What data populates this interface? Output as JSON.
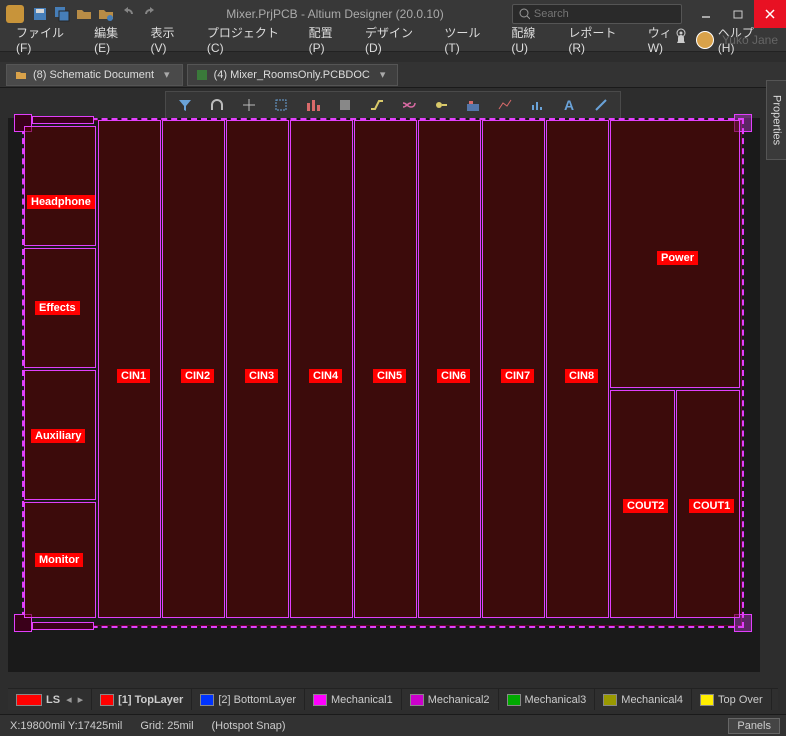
{
  "titlebar": {
    "title": "Mixer.PrjPCB - Altium Designer (20.0.10)",
    "search_placeholder": "Search"
  },
  "menu": {
    "file": "ファイル (F)",
    "edit": "編集 (E)",
    "view": "表示 (V)",
    "project": "プロジェクト (C)",
    "place": "配置 (P)",
    "design": "デザイン (D)",
    "tool": "ツール (T)",
    "route": "配線 (U)",
    "report": "レポート (R)",
    "win": "ウィ",
    "w_suffix": "W)",
    "help": "ヘルプ (H)",
    "user": "Yuko Jane"
  },
  "tabs": {
    "project": "(8) Schematic Document",
    "doc": "(4) Mixer_RoomsOnly.PCBDOC"
  },
  "rooms": {
    "headphone": "Headphone",
    "effects": "Effects",
    "auxiliary": "Auxiliary",
    "monitor": "Monitor",
    "cin1": "CIN1",
    "cin2": "CIN2",
    "cin3": "CIN3",
    "cin4": "CIN4",
    "cin5": "CIN5",
    "cin6": "CIN6",
    "cin7": "CIN7",
    "cin8": "CIN8",
    "power": "Power",
    "cout1": "COUT1",
    "cout2": "COUT2"
  },
  "layers": {
    "ls": "LS",
    "top": "[1] TopLayer",
    "bottom": "[2] BottomLayer",
    "m1": "Mechanical1",
    "m2": "Mechanical2",
    "m3": "Mechanical3",
    "m4": "Mechanical4",
    "tover": "Top Over"
  },
  "colors": {
    "top": "#ff0000",
    "bottom": "#0033ff",
    "m1": "#ff00ff",
    "m2": "#cc00cc",
    "m3": "#00aa00",
    "m4": "#999900",
    "tover": "#ffee00"
  },
  "status": {
    "coords": "X:19800mil Y:17425mil",
    "grid": "Grid: 25mil",
    "snap": "(Hotspot Snap)",
    "panels": "Panels"
  },
  "props_label": "Properties"
}
